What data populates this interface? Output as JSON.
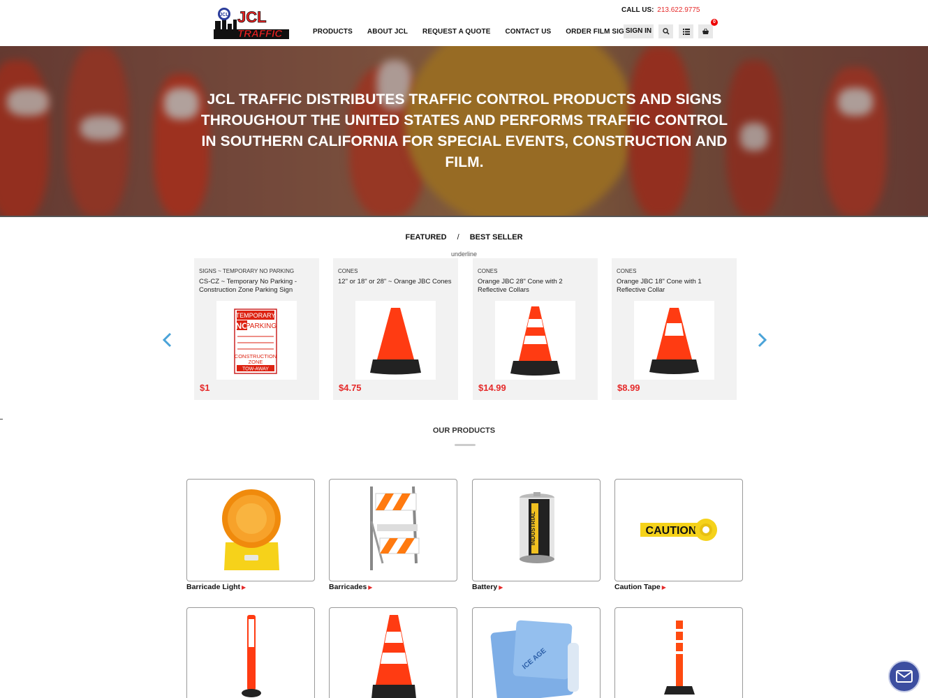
{
  "header": {
    "logo_text": "JCL TRAFFIC",
    "logo_badge": "JCL",
    "call_label": "CALL US:",
    "phone": "213.622.9775",
    "nav": [
      "PRODUCTS",
      "ABOUT JCL",
      "REQUEST A QUOTE",
      "CONTACT US",
      "ORDER FILM SIGNS"
    ],
    "signin": "SIGN IN",
    "cart_count": "0"
  },
  "hero": {
    "headline": "JCL TRAFFIC DISTRIBUTES TRAFFIC CONTROL PRODUCTS AND SIGNS THROUGHOUT THE UNITED STATES AND PERFORMS TRAFFIC CONTROL IN SOUTHERN CALIFORNIA FOR SPECIAL EVENTS, CONSTRUCTION AND FILM."
  },
  "tabs": {
    "featured": "FEATURED",
    "separator": "/",
    "best_seller": "BEST SELLER",
    "underline_label": "underline"
  },
  "carousel": [
    {
      "category": "SIGNS ~ TEMPORARY NO PARKING",
      "title": "CS-CZ ~ Temporary No Parking - Construction Zone Parking Sign",
      "price": "$1"
    },
    {
      "category": "CONES",
      "title": "12\" or 18\" or 28\" ~ Orange JBC Cones",
      "price": "$4.75"
    },
    {
      "category": "CONES",
      "title": "Orange JBC 28\" Cone with 2 Reflective Collars",
      "price": "$14.99"
    },
    {
      "category": "CONES",
      "title": "Orange JBC 18\" Cone with 1 Reflective Collar",
      "price": "$8.99"
    }
  ],
  "sign_text": {
    "temporary": "TEMPORARY",
    "no": "NO",
    "parking": "PARKING",
    "construction": "CONSTRUCTION",
    "zone": "ZONE",
    "tow_away": "TOW-AWAY"
  },
  "our_products": {
    "heading": "OUR PRODUCTS",
    "items": [
      {
        "label": "Barricade Light"
      },
      {
        "label": "Barricades"
      },
      {
        "label": "Battery"
      },
      {
        "label": "Caution Tape"
      },
      {
        "label": ""
      },
      {
        "label": ""
      },
      {
        "label": ""
      },
      {
        "label": ""
      }
    ],
    "battery_text": "INDUSTRIAL",
    "tape_text": "CAUTION",
    "towel_text": "ICE AGE"
  },
  "colors": {
    "accent_red": "#e52a2a",
    "cone_orange": "#ff3b12",
    "mail_blue": "#3c4ea0"
  }
}
